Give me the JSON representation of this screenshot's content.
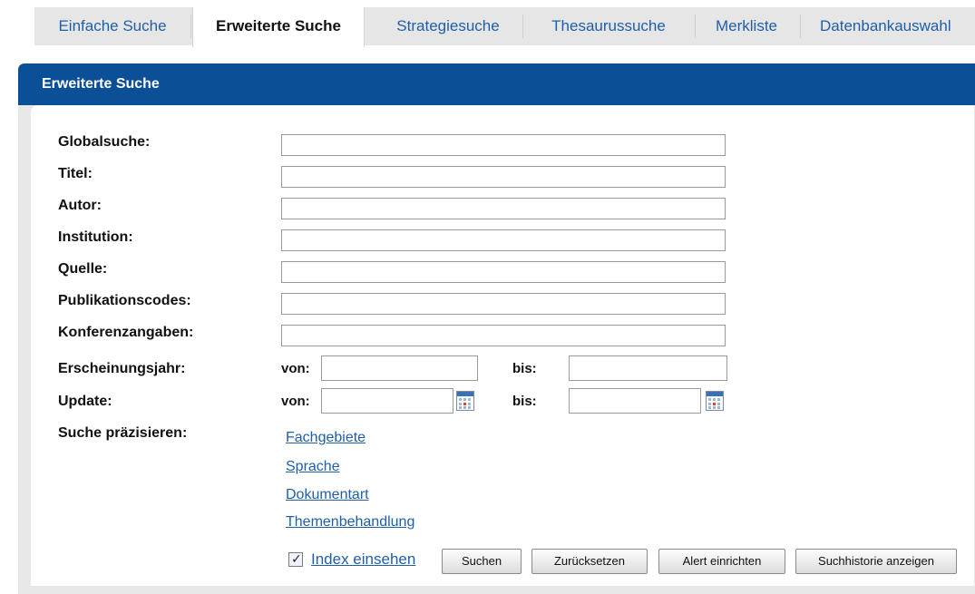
{
  "tabs": [
    {
      "label": "Einfache Suche"
    },
    {
      "label": "Erweiterte Suche"
    },
    {
      "label": "Strategiesuche"
    },
    {
      "label": "Thesaurussuche"
    },
    {
      "label": "Merkliste"
    },
    {
      "label": "Datenbankauswahl"
    }
  ],
  "panel": {
    "title": "Erweiterte Suche"
  },
  "form": {
    "fields": [
      {
        "label": "Globalsuche:",
        "value": ""
      },
      {
        "label": "Titel:",
        "value": ""
      },
      {
        "label": "Autor:",
        "value": ""
      },
      {
        "label": "Institution:",
        "value": ""
      },
      {
        "label": "Quelle:",
        "value": ""
      },
      {
        "label": "Publikationscodes:",
        "value": ""
      },
      {
        "label": "Konferenzangaben:",
        "value": ""
      }
    ],
    "year": {
      "label": "Erscheinungsjahr:",
      "from_label": "von:",
      "to_label": "bis:",
      "from_value": "",
      "to_value": ""
    },
    "update": {
      "label": "Update:",
      "from_label": "von:",
      "to_label": "bis:",
      "from_value": "",
      "to_value": ""
    },
    "refine": {
      "label": "Suche präzisieren:",
      "links": [
        "Fachgebiete",
        "Sprache",
        "Dokumentart",
        "Themenbehandlung"
      ]
    },
    "index": {
      "label": "Index einsehen",
      "checked": true
    },
    "buttons": {
      "search": "Suchen",
      "reset": "Zurücksetzen",
      "alert": "Alert einrichten",
      "history": "Suchhistorie anzeigen"
    }
  },
  "colors": {
    "header": "#0b4f97",
    "link": "#1f5fa8"
  },
  "icons": {
    "calendar": "calendar-icon",
    "checkbox_mark": "✓"
  }
}
